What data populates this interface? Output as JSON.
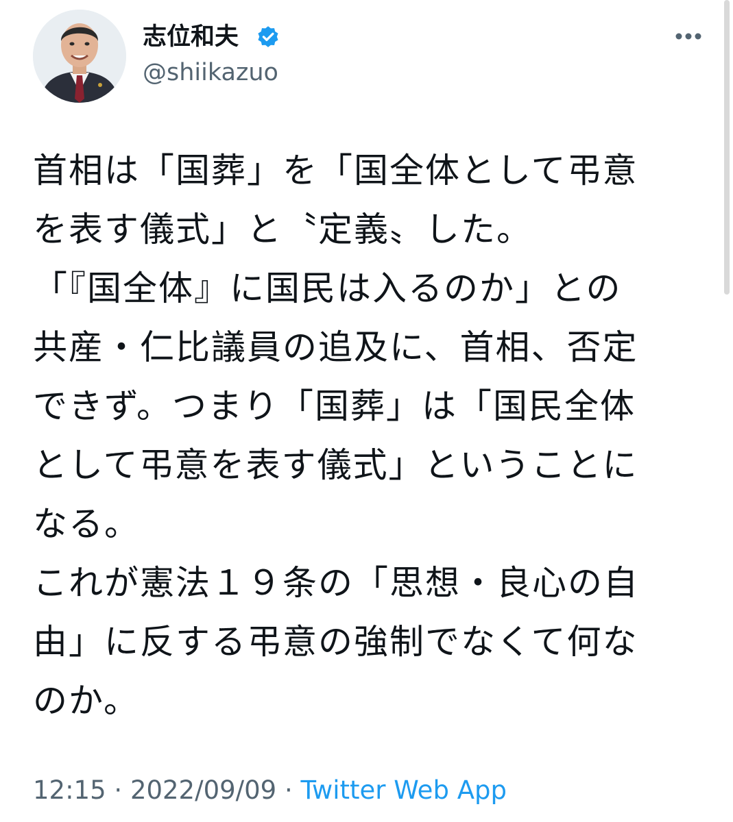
{
  "author": {
    "display_name": "志位和夫",
    "handle": "@shiikazuo",
    "verified": true,
    "avatar_icon": "profile-photo-man-in-suit",
    "verified_icon": "verified-badge-icon"
  },
  "menu": {
    "icon": "more-options-icon"
  },
  "tweet": {
    "lines": [
      "首相は「国葬」を「国全体として弔意",
      "を表す儀式」と〝定義〟した。",
      "「『国全体』に国民は入るのか」との",
      "共産・仁比議員の追及に、首相、否定",
      "できず。つまり「国葬」は「国民全体",
      "として弔意を表す儀式」ということに",
      "なる。",
      "これが憲法１９条の「思想・良心の自",
      "由」に反する弔意の強制でなくて何な",
      "のか。"
    ]
  },
  "meta": {
    "time": "12:15",
    "separator1": " · ",
    "date": "2022/09/09",
    "separator2": " · ",
    "source": "Twitter Web App"
  },
  "colors": {
    "text": "#0f1419",
    "secondary": "#536471",
    "link": "#1d9bf0",
    "verified": "#1d9bf0"
  }
}
